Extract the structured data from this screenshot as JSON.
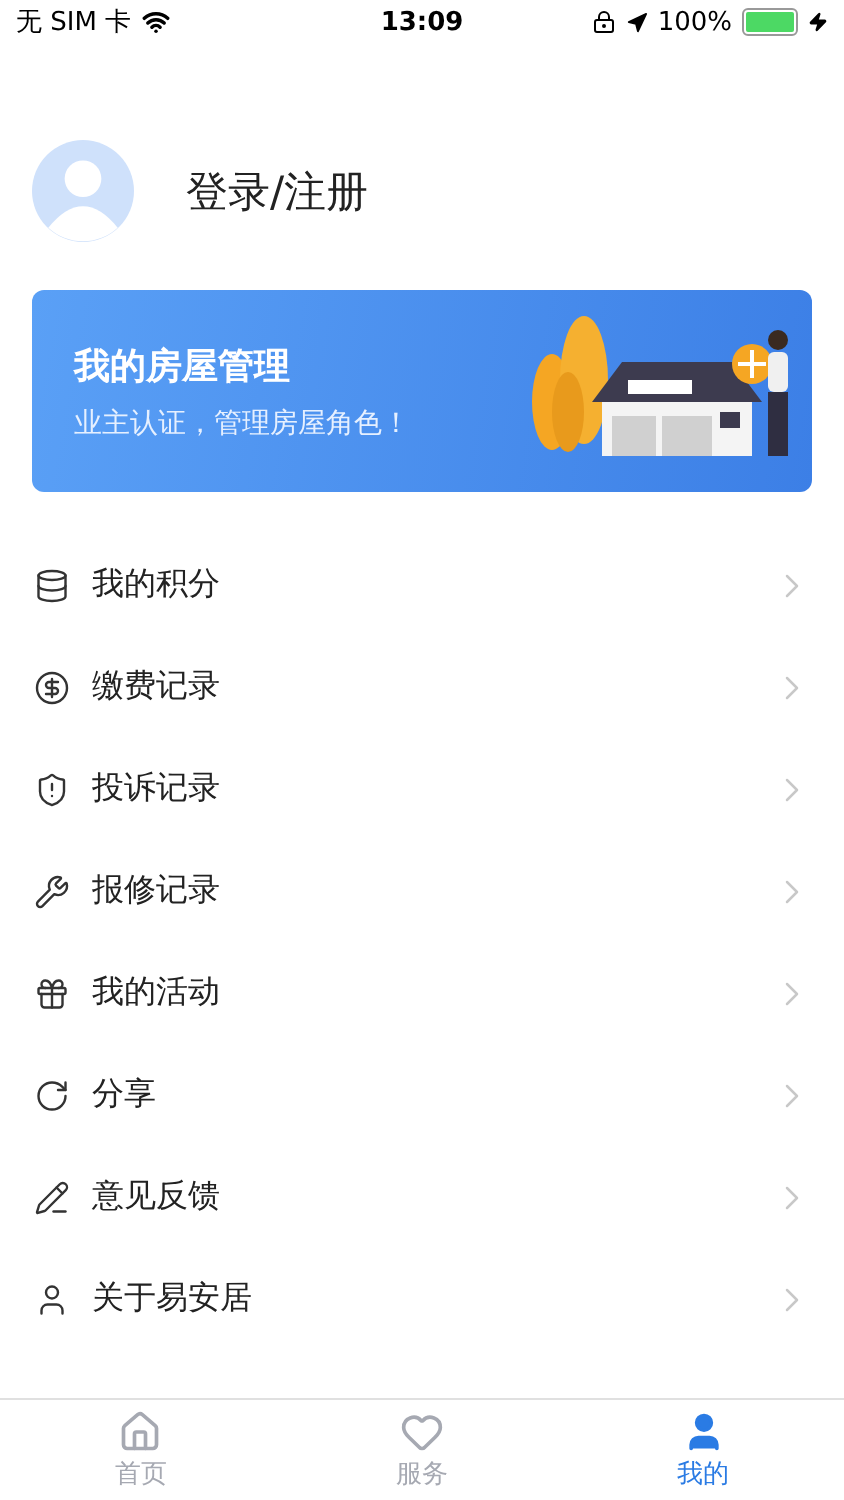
{
  "status_bar": {
    "carrier": "无 SIM 卡",
    "time": "13:09",
    "battery": "100%"
  },
  "profile": {
    "login": "登录/注册"
  },
  "banner": {
    "title": "我的房屋管理",
    "subtitle": "业主认证，管理房屋角色！"
  },
  "menu": [
    {
      "label": "我的积分"
    },
    {
      "label": "缴费记录"
    },
    {
      "label": "投诉记录"
    },
    {
      "label": "报修记录"
    },
    {
      "label": "我的活动"
    },
    {
      "label": "分享"
    },
    {
      "label": "意见反馈"
    },
    {
      "label": "关于易安居"
    }
  ],
  "tabs": [
    {
      "label": "首页",
      "selected": false
    },
    {
      "label": "服务",
      "selected": false
    },
    {
      "label": "我的",
      "selected": true
    }
  ]
}
